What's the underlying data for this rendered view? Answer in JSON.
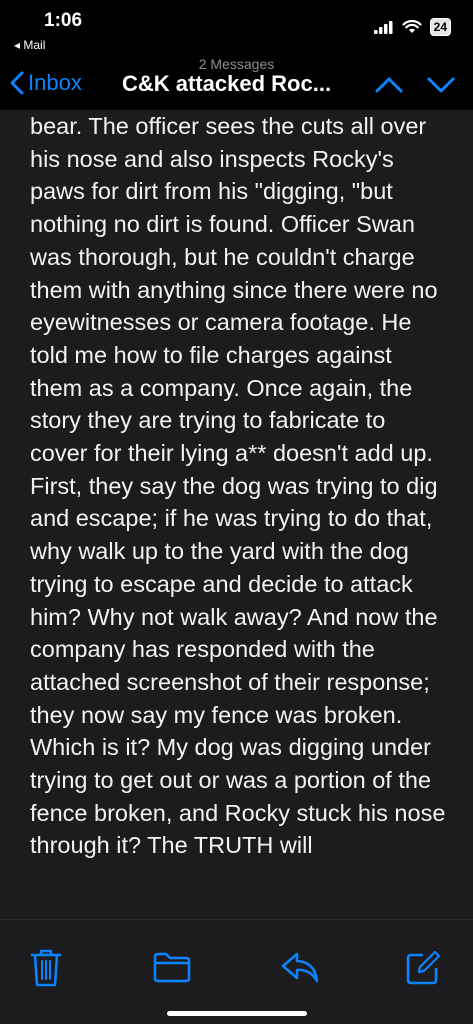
{
  "status": {
    "time": "1:06",
    "back_app": "◂ Mail",
    "battery": "24"
  },
  "nav": {
    "message_count": "2 Messages",
    "back_label": "Inbox",
    "subject": "C&K attacked Roc..."
  },
  "email": {
    "body": "bear. The officer sees the cuts all over his nose and also inspects Rocky's paws for dirt from his \"digging, \"but nothing no dirt is found. Officer Swan was thorough, but he couldn't charge them with anything since there were no eyewitnesses or camera footage. He told me how to file charges against them as a company. Once again, the story they are trying to fabricate to cover for their lying a** doesn't add up. First, they say the dog was trying to dig and escape; if he was trying to do that, why walk up to the yard with the dog trying to escape and decide to attack him? Why not walk away? And now the company has responded with the attached screenshot of their response; they now say my fence was broken. Which is it? My dog was digging under trying to get out or was a portion of the fence broken, and Rocky stuck his nose through it? The TRUTH will"
  },
  "colors": {
    "accent": "#0a84ff",
    "background": "#1c1c1e"
  },
  "toolbar": {
    "icons": [
      "trash-icon",
      "folder-icon",
      "reply-icon",
      "compose-icon"
    ]
  }
}
